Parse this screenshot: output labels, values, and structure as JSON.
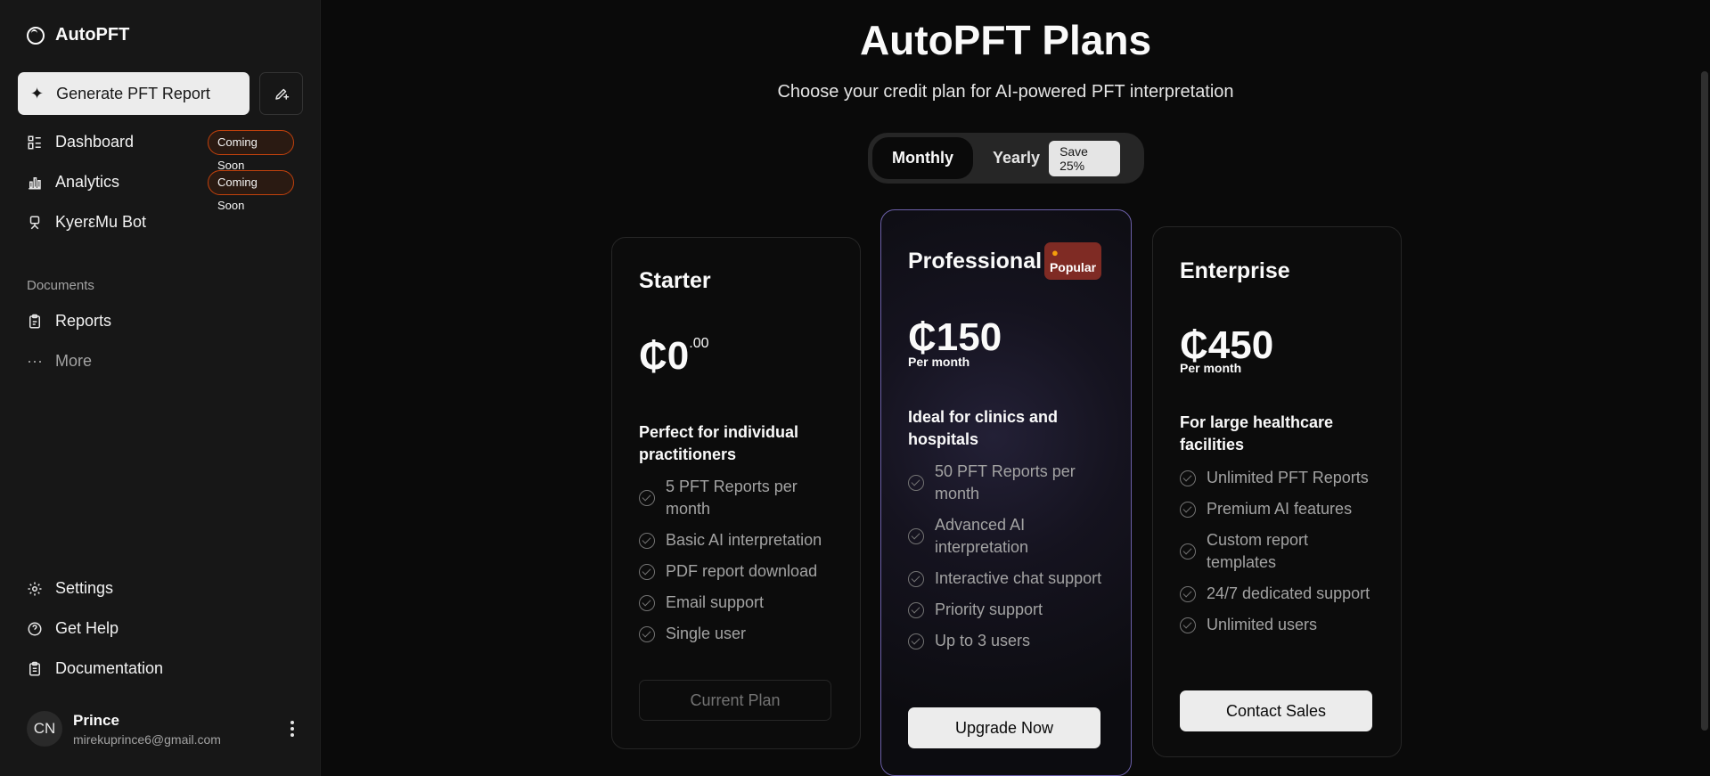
{
  "sidebar": {
    "brand": "AutoPFT",
    "generate_label": "Generate PFT Report",
    "nav": [
      {
        "label": "Dashboard",
        "badge": "Coming Soon",
        "icon": "dashboard-icon"
      },
      {
        "label": "Analytics",
        "badge": "Coming Soon",
        "icon": "bar-chart-icon"
      },
      {
        "label": "KyerεMu Bot",
        "icon": "bot-icon"
      }
    ],
    "documents_label": "Documents",
    "documents": [
      {
        "label": "Reports",
        "icon": "clipboard-icon"
      },
      {
        "label": "More",
        "icon": "more-horizontal-icon"
      }
    ],
    "footer_nav": [
      {
        "label": "Settings",
        "icon": "gear-icon"
      },
      {
        "label": "Get Help",
        "icon": "help-circle-icon"
      },
      {
        "label": "Documentation",
        "icon": "document-icon"
      }
    ],
    "user": {
      "initials": "CN",
      "name": "Prince",
      "email": "mirekuprince6@gmail.com"
    }
  },
  "header": {
    "title": "AutoPFT Plans",
    "subtitle": "Choose your credit plan for AI-powered PFT interpretation"
  },
  "billing_toggle": {
    "monthly": "Monthly",
    "yearly": "Yearly",
    "save_badge": "Save 25%",
    "selected": "Monthly"
  },
  "plans": [
    {
      "name": "Starter",
      "price": "₵0",
      "price_cents": ".00",
      "description": "Perfect for individual practitioners",
      "features": [
        "5 PFT Reports per month",
        "Basic AI interpretation",
        "PDF report download",
        "Email support",
        "Single user"
      ],
      "button": "Current Plan"
    },
    {
      "name": "Professional",
      "badge": "Popular",
      "price": "₵150",
      "period": "Per month",
      "description": "Ideal for clinics and hospitals",
      "features": [
        "50 PFT Reports per month",
        "Advanced AI interpretation",
        "Interactive chat support",
        "Priority support",
        "Up to 3 users"
      ],
      "button": "Upgrade Now"
    },
    {
      "name": "Enterprise",
      "price": "₵450",
      "period": "Per month",
      "description": "For large healthcare facilities",
      "features": [
        "Unlimited PFT Reports",
        "Premium AI features",
        "Custom report templates",
        "24/7 dedicated support",
        "Unlimited users"
      ],
      "button": "Contact Sales"
    }
  ]
}
